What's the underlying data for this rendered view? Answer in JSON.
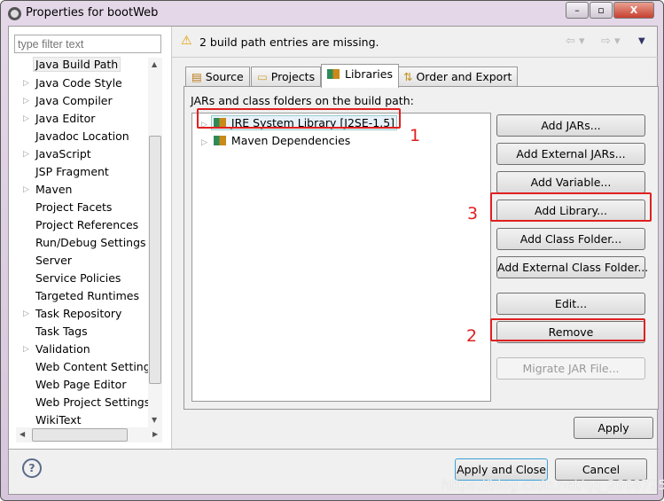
{
  "window": {
    "title": "Properties for bootWeb",
    "minimize": "–",
    "maximize": "▫",
    "close": "X"
  },
  "sidebar": {
    "filter_placeholder": "type filter text",
    "items": [
      {
        "label": "Java Build Path",
        "expandable": false,
        "selected": true
      },
      {
        "label": "Java Code Style",
        "expandable": true
      },
      {
        "label": "Java Compiler",
        "expandable": true
      },
      {
        "label": "Java Editor",
        "expandable": true
      },
      {
        "label": "Javadoc Location",
        "expandable": false
      },
      {
        "label": "JavaScript",
        "expandable": true
      },
      {
        "label": "JSP Fragment",
        "expandable": false
      },
      {
        "label": "Maven",
        "expandable": true
      },
      {
        "label": "Project Facets",
        "expandable": false
      },
      {
        "label": "Project References",
        "expandable": false
      },
      {
        "label": "Run/Debug Settings",
        "expandable": false
      },
      {
        "label": "Server",
        "expandable": false
      },
      {
        "label": "Service Policies",
        "expandable": false
      },
      {
        "label": "Targeted Runtimes",
        "expandable": false
      },
      {
        "label": "Task Repository",
        "expandable": true
      },
      {
        "label": "Task Tags",
        "expandable": false
      },
      {
        "label": "Validation",
        "expandable": true
      },
      {
        "label": "Web Content Settings",
        "expandable": false
      },
      {
        "label": "Web Page Editor",
        "expandable": false
      },
      {
        "label": "Web Project Settings",
        "expandable": false
      },
      {
        "label": "WikiText",
        "expandable": false
      }
    ]
  },
  "header": {
    "message": "2 build path entries are missing."
  },
  "tabs": [
    {
      "label": "Source"
    },
    {
      "label": "Projects"
    },
    {
      "label": "Libraries",
      "active": true
    },
    {
      "label": "Order and Export"
    }
  ],
  "libraries": {
    "caption": "JARs and class folders on the build path:",
    "entries": [
      "JRE System Library [J2SE-1.5]",
      "Maven Dependencies"
    ]
  },
  "buttons": {
    "add_jars": "Add JARs...",
    "add_external_jars": "Add External JARs...",
    "add_variable": "Add Variable...",
    "add_library": "Add Library...",
    "add_class_folder": "Add Class Folder...",
    "add_external_class_folder": "Add External Class Folder...",
    "edit": "Edit...",
    "remove": "Remove",
    "migrate": "Migrate JAR File...",
    "apply": "Apply",
    "apply_close": "Apply and Close",
    "cancel": "Cancel"
  },
  "annotations": {
    "one": "1",
    "two": "2",
    "three": "3"
  },
  "watermark": "https://blog.csdn.net/qq_26687255",
  "colors": {
    "annotation": "#e02020"
  }
}
